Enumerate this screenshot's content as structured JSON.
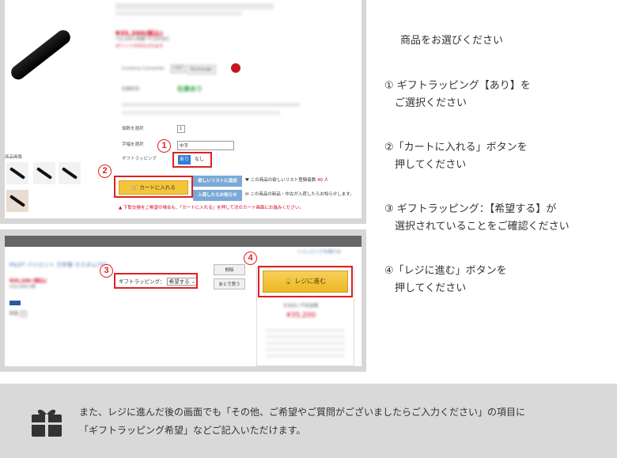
{
  "instructions": {
    "heading": "商品をお選びください",
    "step1": "① ギフトラッピング【あり】を\n　ご選択ください",
    "step2": "②「カートに入れる」ボタンを\n　押してください",
    "step3": "③ ギフトラッピング：【希望する】が\n　選択されていることをご確認ください",
    "step4": "④「レジに進む」ボタンを\n　押してください"
  },
  "footer": {
    "line1": "また、レジに進んだ後の画面でも「その他、ご希望やご質問がございましたらご入力ください」の項目に",
    "line2": "「ギフトラッピング希望」などご記入いただけます。",
    "icon": "gift-icon"
  },
  "product_page": {
    "price": "¥35,200(税込)",
    "price_note": "*32,000+税額 *3,200含む",
    "point_note": "ポイントが付与されます",
    "currency_label": "Currency Converter",
    "currency_select": "USD",
    "exchange_button": "Exchange",
    "stock_label": "在庫状況",
    "stock_value": "在庫あり",
    "qty_label": "個数を選択",
    "qty_value": "1",
    "nib_label": "字幅を選択",
    "nib_value": "中字",
    "wrap_label": "ギフトラッピング",
    "wrap_yes": "あり",
    "wrap_no": "なし",
    "cart_button": "カートに入れる",
    "wishlist_button": "欲しいリストに追加",
    "wishlist_note": "この商品の欲しいリスト登録者数",
    "wishlist_count": "40",
    "wishlist_unit": "人",
    "notify_button": "入荷したらお知らせ",
    "notify_note": "この商品の新品・中古が入荷したらお知らせします。",
    "warning": "下取交換をご希望の場合も、「カートに入れる」を押して次のカート画面にお進みください。",
    "thumbs_label": "商品画像"
  },
  "cart_page": {
    "top_link": "ショッピングを続ける",
    "item_title": "PILOT パイロット 万年筆 カスタム743",
    "item_price": "¥35,200 (税込)",
    "item_note": "¥32,000+税",
    "wrap_label": "ギフトラッピング：",
    "wrap_value": "希望する",
    "delete_button": "削除",
    "later_button": "あとで買う",
    "checkout_button": "レジに進む",
    "total_label": "お支払い予定金額",
    "total_value": "¥35,200",
    "qty_label": "数量",
    "qty_value": "1"
  },
  "colors": {
    "callout_red": "#e02020",
    "cart_yellow": "#f4c43a",
    "footer_bg": "#d9d9d9"
  }
}
